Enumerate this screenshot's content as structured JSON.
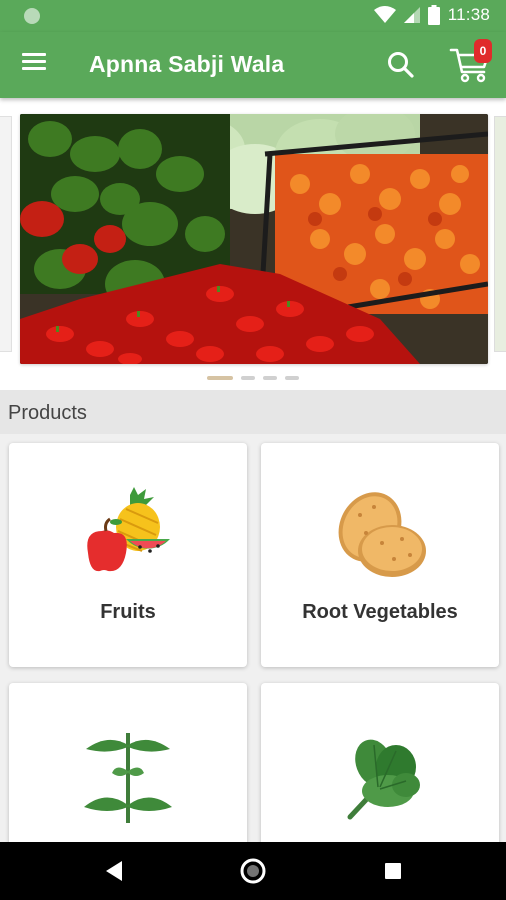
{
  "status_bar": {
    "time": "11:38",
    "icons": [
      "notification-dot-icon",
      "wifi-icon",
      "cellular-signal-icon",
      "battery-icon"
    ]
  },
  "app_bar": {
    "title": "Apnna Sabji Wala",
    "icons": [
      "menu-icon",
      "search-icon",
      "cart-icon"
    ],
    "cart_count": "0"
  },
  "carousel": {
    "slides_count": 4,
    "active_index": 0
  },
  "products": {
    "title": "Products",
    "categories": [
      {
        "label": "Fruits",
        "icon": "fruits-icon"
      },
      {
        "label": "Root Vegetables",
        "icon": "potato-icon"
      },
      {
        "label": "",
        "icon": "herb-icon"
      },
      {
        "label": "",
        "icon": "leafy-greens-icon"
      }
    ]
  },
  "nav_bar": {
    "icons": [
      "back-icon",
      "home-icon",
      "recents-icon"
    ]
  },
  "colors": {
    "primary": "#5aa95a",
    "badge": "#e02b2b",
    "section_header": "#e6e6e6"
  }
}
